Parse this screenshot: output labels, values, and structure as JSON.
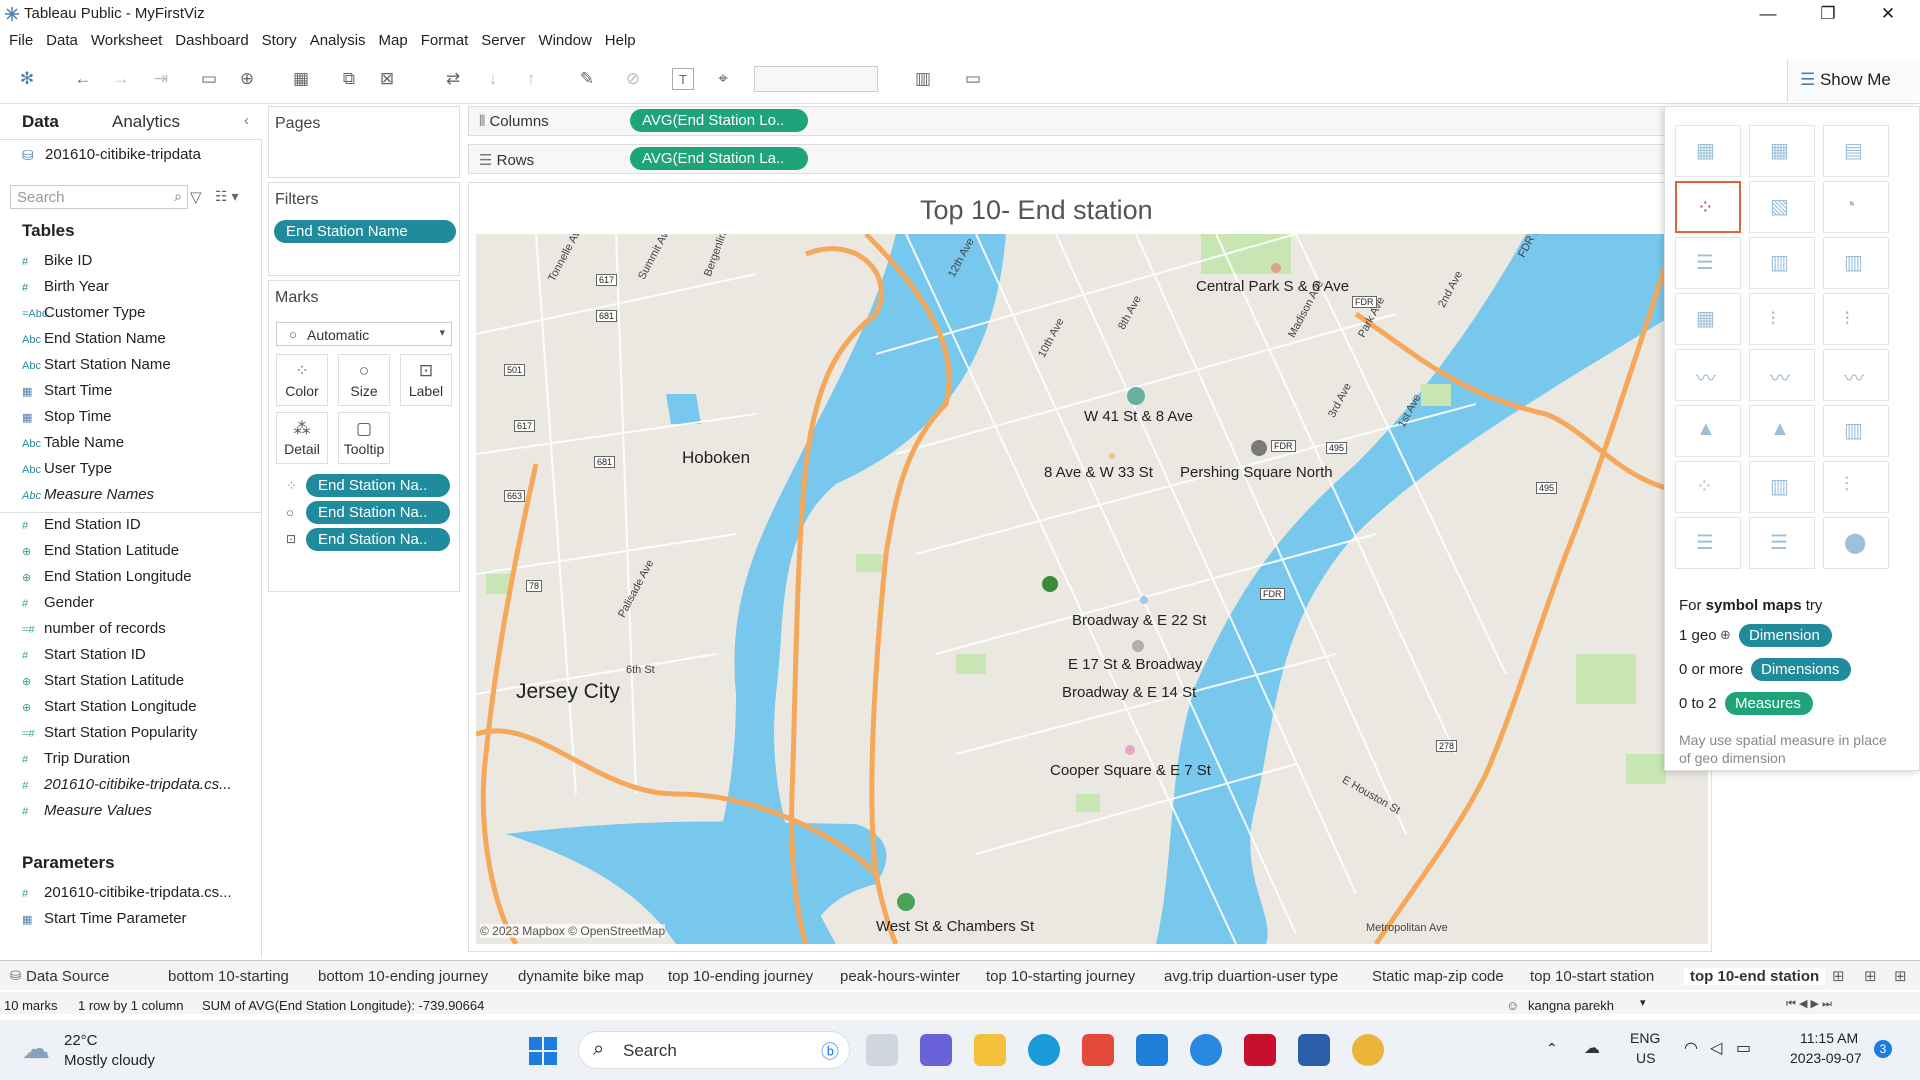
{
  "window": {
    "title": "Tableau Public - MyFirstViz"
  },
  "menu": [
    "File",
    "Data",
    "Worksheet",
    "Dashboard",
    "Story",
    "Analysis",
    "Map",
    "Format",
    "Server",
    "Window",
    "Help"
  ],
  "toolbar": {
    "show_me_label": "Show Me"
  },
  "data_pane": {
    "tabs": [
      "Data",
      "Analytics"
    ],
    "source": "201610-citibike-tripdata",
    "search_placeholder": "Search",
    "tables_heading": "Tables",
    "dimensions": [
      {
        "icon": "#",
        "name": "Bike ID"
      },
      {
        "icon": "#",
        "name": "Birth Year"
      },
      {
        "icon": "=Abc",
        "name": "Customer Type"
      },
      {
        "icon": "Abc",
        "name": "End Station Name"
      },
      {
        "icon": "Abc",
        "name": "Start Station Name"
      },
      {
        "icon": "cal",
        "name": "Start Time"
      },
      {
        "icon": "cal",
        "name": "Stop Time"
      },
      {
        "icon": "Abc",
        "name": "Table Name"
      },
      {
        "icon": "Abc",
        "name": "User Type"
      },
      {
        "icon": "Abc",
        "name": "Measure Names",
        "italic": true
      }
    ],
    "measures": [
      {
        "icon": "#",
        "name": "End Station ID"
      },
      {
        "icon": "geo",
        "name": "End Station Latitude"
      },
      {
        "icon": "geo",
        "name": "End Station Longitude"
      },
      {
        "icon": "#",
        "name": "Gender"
      },
      {
        "icon": "=#",
        "name": "number of records"
      },
      {
        "icon": "#",
        "name": "Start Station ID"
      },
      {
        "icon": "geo",
        "name": "Start Station Latitude"
      },
      {
        "icon": "geo",
        "name": "Start Station Longitude"
      },
      {
        "icon": "=#",
        "name": "Start Station Popularity"
      },
      {
        "icon": "#",
        "name": "Trip Duration"
      },
      {
        "icon": "#",
        "name": "201610-citibike-tripdata.cs...",
        "italic": true
      },
      {
        "icon": "#",
        "name": "Measure Values",
        "italic": true
      }
    ],
    "parameters_heading": "Parameters",
    "parameters": [
      {
        "icon": "#",
        "name": "201610-citibike-tripdata.cs..."
      },
      {
        "icon": "cal",
        "name": "Start Time Parameter"
      }
    ]
  },
  "cards": {
    "pages": "Pages",
    "filters": "Filters",
    "filter_pill": "End Station Name",
    "marks": "Marks",
    "mark_type": "Automatic",
    "mark_buttons": [
      "Color",
      "Size",
      "Label",
      "Detail",
      "Tooltip"
    ],
    "mark_pills": [
      "End Station Na..",
      "End Station Na..",
      "End Station Na.."
    ]
  },
  "shelves": {
    "columns_label": "Columns",
    "columns_pill": "AVG(End Station Lo..",
    "rows_label": "Rows",
    "rows_pill": "AVG(End Station La.."
  },
  "viz": {
    "title": "Top 10- End station",
    "attribution": "© 2023 Mapbox © OpenStreetMap",
    "stations": [
      {
        "name": "Central Park S & 6 Ave",
        "color": "#e0a090"
      },
      {
        "name": "W 41 St & 8 Ave",
        "color": "#6aaea2"
      },
      {
        "name": "8 Ave & W 33 St",
        "color": "#f1c27d"
      },
      {
        "name": "Pershing Square North",
        "color": "#7a7a7a"
      },
      {
        "name": "Broadway & E 22 St",
        "color": "#3a8a3a"
      },
      {
        "name": "E 17 St & Broadway",
        "color": "#9ccbe8"
      },
      {
        "name": "Broadway & E 14 St",
        "color": "#b0b0b0"
      },
      {
        "name": "Cooper Square & E 7 St",
        "color": "#e8a6c2"
      },
      {
        "name": "West St & Chambers St",
        "color": "#4aa35a"
      }
    ],
    "place_labels": [
      "Hoboken",
      "Jersey City"
    ],
    "street_labels": [
      "Tonnelle Ave",
      "Summit Ave",
      "Bergenline Av",
      "12th Ave",
      "10th Ave",
      "8th Ave",
      "Madison Ave",
      "Park Ave",
      "3rd Ave",
      "2nd Ave",
      "1st Ave",
      "FDR Dr",
      "6th St",
      "Palisade Ave",
      "E Houston St",
      "Metropolitan Ave"
    ],
    "shields": [
      "617",
      "681",
      "501",
      "617",
      "681",
      "663",
      "495",
      "495",
      "78",
      "278",
      "FDR",
      "FDR",
      "FDR"
    ]
  },
  "show_me": {
    "hint_lead": "For ",
    "hint_bold": "symbol maps",
    "hint_tail": " try",
    "rows": [
      {
        "prefix": "1 geo",
        "pill": "Dimension"
      },
      {
        "prefix": "0 or more",
        "pill": "Dimensions"
      },
      {
        "prefix": "0 to 2",
        "pill": "Measures"
      }
    ],
    "note": "May use spatial measure in place of geo dimension"
  },
  "sheet_tabs": [
    "Data Source",
    "bottom 10-starting",
    "bottom 10-ending journey",
    "dynamite bike map",
    "top 10-ending journey",
    "peak-hours-winter",
    "top 10-starting journey",
    "avg.trip duartion-user type",
    "Static map-zip code",
    "top 10-start station",
    "top 10-end station"
  ],
  "status_bar": {
    "marks": "10 marks",
    "rows_cols": "1 row by 1 column",
    "sum": "SUM of AVG(End Station Longitude): -739.90664",
    "user": "kangna parekh"
  },
  "taskbar": {
    "weather_temp": "22°C",
    "weather_desc": "Mostly cloudy",
    "search_placeholder": "Search",
    "lang": "ENG",
    "region": "US",
    "time": "11:15 AM",
    "date": "2023-09-07",
    "notif_count": "3"
  }
}
